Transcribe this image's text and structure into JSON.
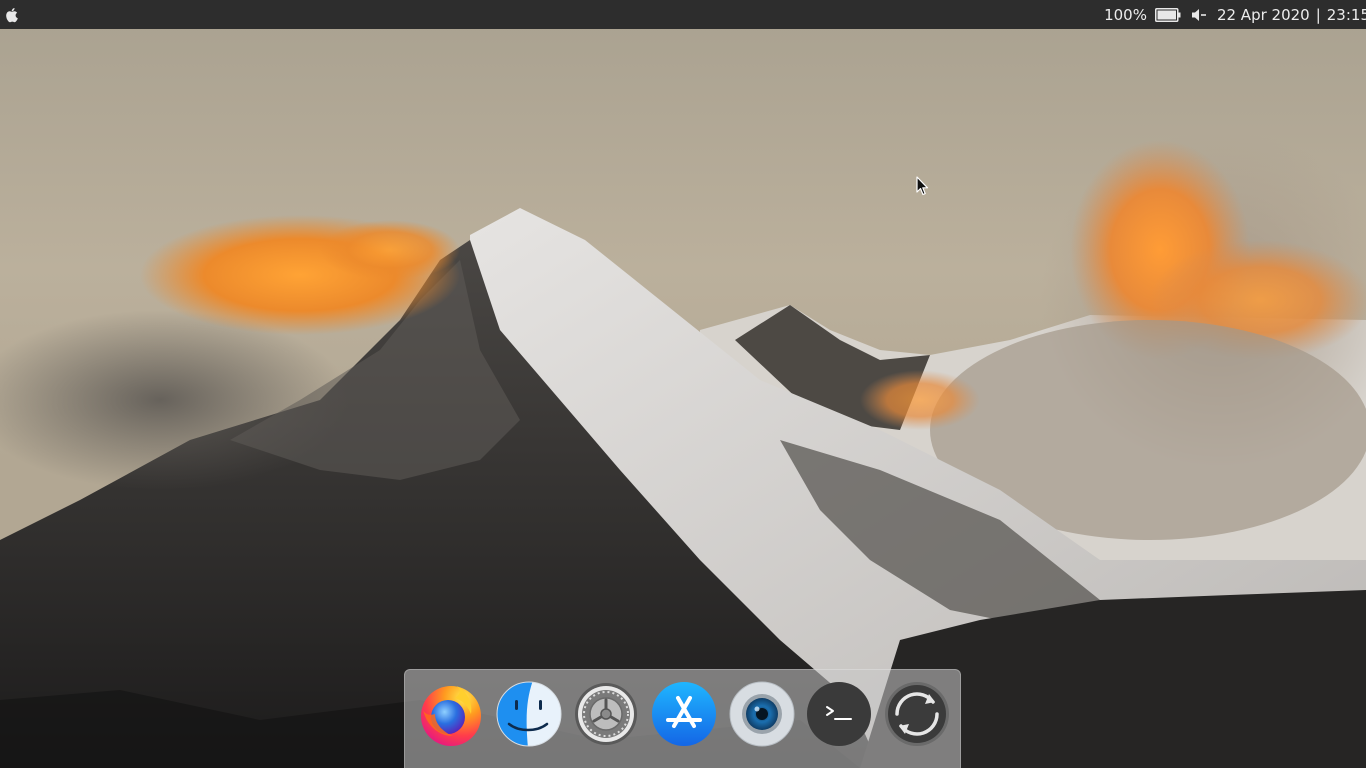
{
  "menubar": {
    "apple_icon": "apple-icon",
    "battery_percent": "100%",
    "battery_icon": "battery-icon",
    "volume_icon": "volume-icon",
    "date": "22 Apr 2020",
    "separator": "|",
    "time": "23:15"
  },
  "dock": {
    "items": [
      {
        "icon": "firefox-icon"
      },
      {
        "icon": "finder-icon"
      },
      {
        "icon": "system-settings-icon"
      },
      {
        "icon": "app-store-icon"
      },
      {
        "icon": "screenshot-camera-icon"
      },
      {
        "icon": "terminal-icon"
      },
      {
        "icon": "refresh-icon"
      }
    ]
  },
  "colors": {
    "menubar_bg": "#2d2d2d",
    "menubar_text": "#ececec",
    "sky": "#b5aa98",
    "cloud_orange": "#ff9a2e"
  }
}
